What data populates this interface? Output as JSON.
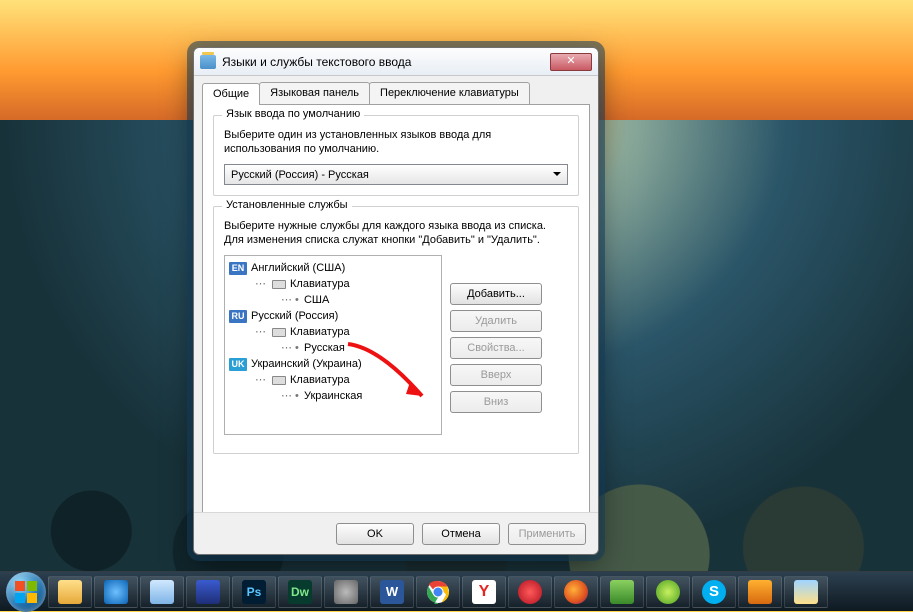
{
  "dialog": {
    "title": "Языки и службы текстового ввода",
    "tabs": {
      "general": "Общие",
      "langbar": "Языковая панель",
      "switch": "Переключение клавиатуры"
    },
    "group_default": {
      "title": "Язык ввода по умолчанию",
      "desc": "Выберите один из установленных языков ввода для использования по умолчанию.",
      "combo_value": "Русский (Россия) - Русская"
    },
    "group_services": {
      "title": "Установленные службы",
      "desc": "Выберите нужные службы для каждого языка ввода из списка. Для изменения списка служат кнопки \"Добавить\" и \"Удалить\".",
      "tree": [
        {
          "badge": "EN",
          "lang": "Английский (США)",
          "kb_label": "Клавиатура",
          "layout": "США"
        },
        {
          "badge": "RU",
          "lang": "Русский (Россия)",
          "kb_label": "Клавиатура",
          "layout": "Русская"
        },
        {
          "badge": "UK",
          "lang": "Украинский (Украина)",
          "kb_label": "Клавиатура",
          "layout": "Украинская"
        }
      ],
      "buttons": {
        "add": "Добавить...",
        "remove": "Удалить",
        "props": "Свойства...",
        "up": "Вверх",
        "down": "Вниз"
      }
    },
    "buttons": {
      "ok": "OK",
      "cancel": "Отмена",
      "apply": "Применить"
    },
    "close_glyph": "✕"
  },
  "taskbar": {
    "items": [
      "start",
      "explorer",
      "ie",
      "notepad",
      "save",
      "photoshop",
      "dreamweaver",
      "settings-gear",
      "word",
      "chrome",
      "yandex",
      "opera",
      "firefox",
      "app-green",
      "icq",
      "skype",
      "media-player",
      "weather"
    ]
  },
  "colors": {
    "arrow": "#e11",
    "badge_blue": "#3a75c4",
    "badge_uk": "#2a9fd6"
  }
}
